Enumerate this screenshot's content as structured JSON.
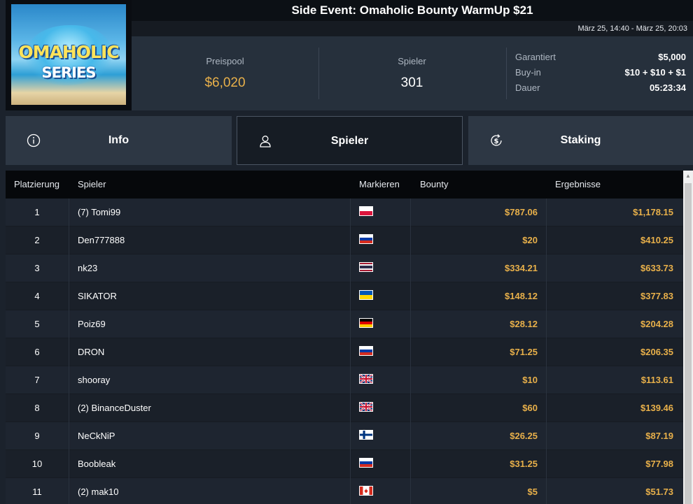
{
  "header": {
    "logo_text_1": "OMAHOLIC",
    "logo_text_2": "SERIES",
    "title": "Side Event: Omaholic Bounty WarmUp $21",
    "date_range": "März 25, 14:40 - März 25, 20:03"
  },
  "stats": {
    "prizepool_label": "Preispool",
    "prizepool_value": "$6,020",
    "players_label": "Spieler",
    "players_value": "301",
    "guaranteed_label": "Garantiert",
    "guaranteed_value": "$5,000",
    "buyin_label": "Buy-in",
    "buyin_value": "$10 + $10 + $1",
    "duration_label": "Dauer",
    "duration_value": "05:23:34"
  },
  "tabs": [
    {
      "label": "Info",
      "icon": "info-icon"
    },
    {
      "label": "Spieler",
      "icon": "user-icon"
    },
    {
      "label": "Staking",
      "icon": "dollar-refresh-icon"
    }
  ],
  "table": {
    "headers": [
      "Platzierung",
      "Spieler",
      "Markieren",
      "Bounty",
      "Ergebnisse"
    ],
    "rows": [
      {
        "place": "1",
        "player": "(7) Tomi99",
        "flag": "pl",
        "bounty": "$787.06",
        "result": "$1,178.15"
      },
      {
        "place": "2",
        "player": "Den777888",
        "flag": "ru",
        "bounty": "$20",
        "result": "$410.25"
      },
      {
        "place": "3",
        "player": "nk23",
        "flag": "th",
        "bounty": "$334.21",
        "result": "$633.73"
      },
      {
        "place": "4",
        "player": "SIKATOR",
        "flag": "ua",
        "bounty": "$148.12",
        "result": "$377.83"
      },
      {
        "place": "5",
        "player": "Poiz69",
        "flag": "de",
        "bounty": "$28.12",
        "result": "$204.28"
      },
      {
        "place": "6",
        "player": "DRON",
        "flag": "ru",
        "bounty": "$71.25",
        "result": "$206.35"
      },
      {
        "place": "7",
        "player": "shooray",
        "flag": "gb",
        "bounty": "$10",
        "result": "$113.61"
      },
      {
        "place": "8",
        "player": "(2) BinanceDuster",
        "flag": "gb",
        "bounty": "$60",
        "result": "$139.46"
      },
      {
        "place": "9",
        "player": "NeCkNiP",
        "flag": "fi",
        "bounty": "$26.25",
        "result": "$87.19"
      },
      {
        "place": "10",
        "player": "Boobleak",
        "flag": "ru",
        "bounty": "$31.25",
        "result": "$77.98"
      },
      {
        "place": "11",
        "player": "(2) mak10",
        "flag": "ca",
        "bounty": "$5",
        "result": "$51.73"
      }
    ]
  },
  "colors": {
    "accent_gold": "#e8b04a",
    "background": "#1b222c"
  }
}
